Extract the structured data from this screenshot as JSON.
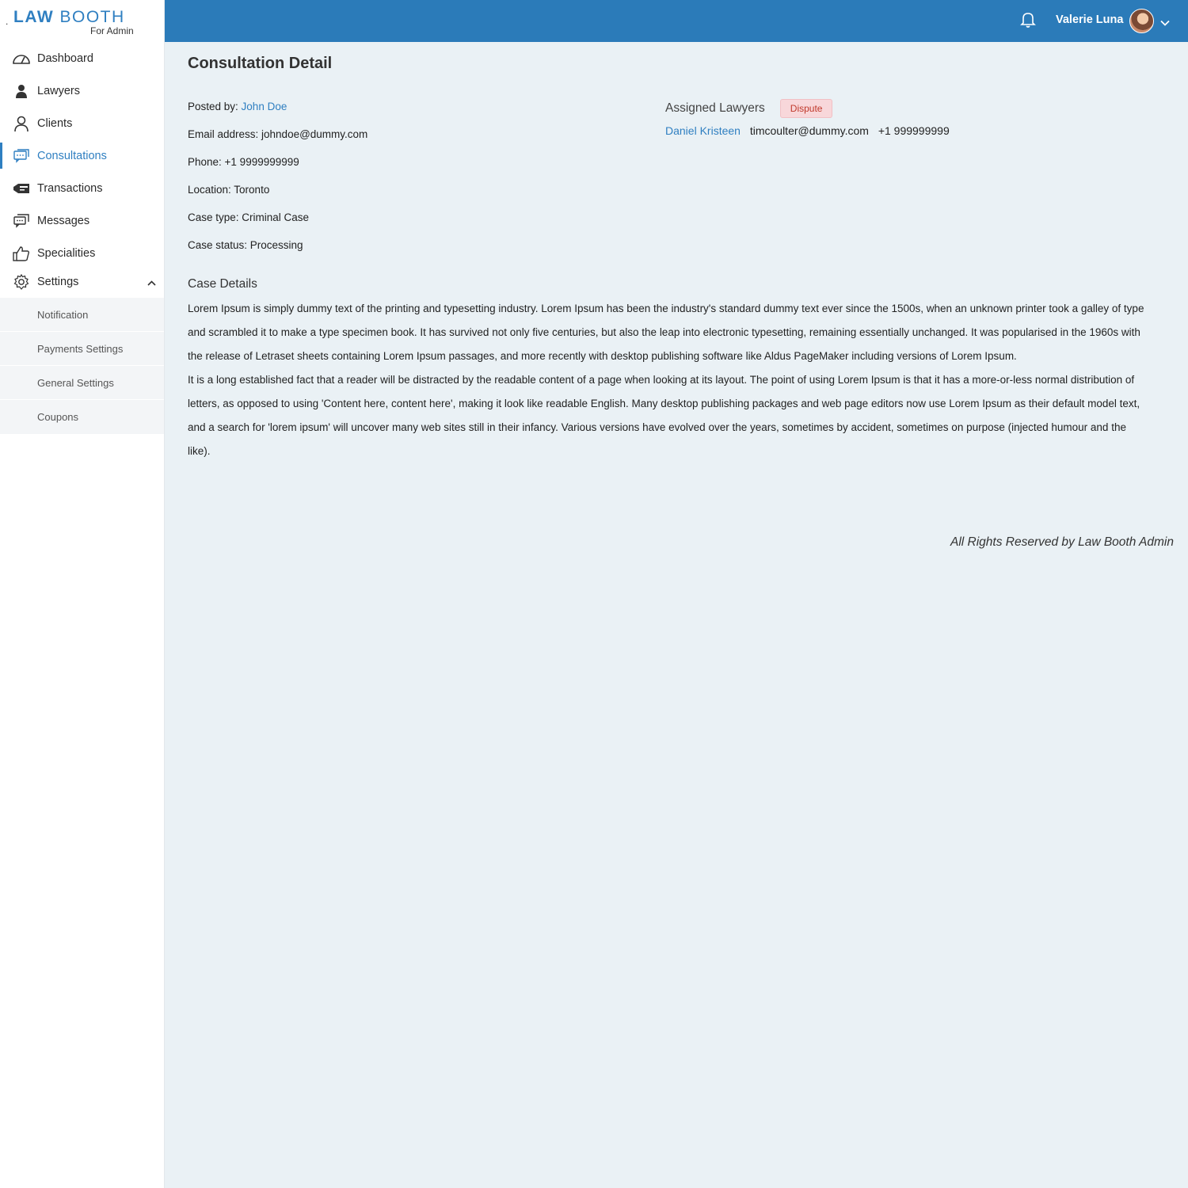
{
  "brand": {
    "dot": ".",
    "law": "LAW",
    "booth": "BOOTH",
    "sub": "For Admin"
  },
  "sidebar": {
    "items": [
      {
        "label": "Dashboard",
        "icon": "dashboard-icon"
      },
      {
        "label": "Lawyers",
        "icon": "lawyer-icon"
      },
      {
        "label": "Clients",
        "icon": "client-icon"
      },
      {
        "label": "Consultations",
        "icon": "consultations-icon",
        "active": true
      },
      {
        "label": "Transactions",
        "icon": "transactions-icon"
      },
      {
        "label": "Messages",
        "icon": "messages-icon"
      },
      {
        "label": "Specialities",
        "icon": "thumbs-up-icon"
      },
      {
        "label": "Settings",
        "icon": "gear-icon",
        "expanded": true
      }
    ],
    "submenu": [
      {
        "label": "Notification"
      },
      {
        "label": "Payments Settings"
      },
      {
        "label": "General Settings"
      },
      {
        "label": "Coupons"
      }
    ]
  },
  "topbar": {
    "user_name": "Valerie Luna",
    "accent": "#2b7bb9"
  },
  "page": {
    "title": "Consultation Detail",
    "posted_by_label": "Posted by: ",
    "posted_by": "John Doe",
    "email_line": "Email address: johndoe@dummy.com",
    "phone_line": "Phone: +1 9999999999",
    "location_line": "Location: Toronto",
    "case_type_line": "Case type: Criminal Case",
    "case_status_line": "Case status: Processing",
    "assigned_title": "Assigned Lawyers",
    "status_badge": "Dispute",
    "lawyer": {
      "name": "Daniel Kristeen",
      "email": "timcoulter@dummy.com",
      "phone": "+1 999999999"
    },
    "case_details_title": "Case Details",
    "case_paragraph_1": "Lorem Ipsum is simply dummy text of the printing and typesetting industry. Lorem Ipsum has been the industry's standard dummy text ever since the 1500s, when an unknown printer took a galley of type and scrambled it to make a type specimen book. It has survived not only five centuries, but also the leap into electronic typesetting, remaining essentially unchanged. It was popularised in the 1960s with the release of Letraset sheets containing Lorem Ipsum passages, and more recently with desktop publishing software like Aldus PageMaker including versions of Lorem Ipsum.",
    "case_paragraph_2": "It is a long established fact that a reader will be distracted by the readable content of a page when looking at its layout. The point of using Lorem Ipsum is that it has a more-or-less normal distribution of letters, as opposed to using 'Content here, content here', making it look like readable English. Many desktop publishing packages and web page editors now use Lorem Ipsum as their default model text, and a search for 'lorem ipsum' will uncover many web sites still in their infancy. Various versions have evolved over the years, sometimes by accident, sometimes on purpose (injected humour and the like)."
  },
  "footer": {
    "text": "All Rights Reserved by Law Booth Admin"
  }
}
